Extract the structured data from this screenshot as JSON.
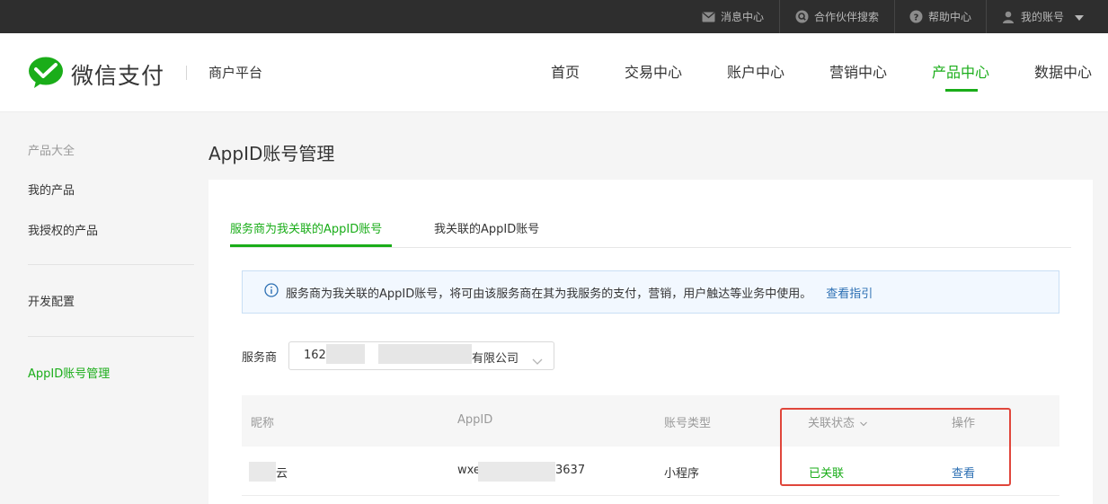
{
  "topbar": {
    "items": [
      {
        "label": "消息中心",
        "icon": "mail-icon"
      },
      {
        "label": "合作伙伴搜索",
        "icon": "search-icon"
      },
      {
        "label": "帮助中心",
        "icon": "help-icon"
      },
      {
        "label": "我的账号",
        "icon": "user-icon"
      }
    ]
  },
  "header": {
    "brand": "微信支付",
    "platform": "商户平台",
    "nav": [
      "首页",
      "交易中心",
      "账户中心",
      "营销中心",
      "产品中心",
      "数据中心"
    ],
    "active_nav": "产品中心"
  },
  "sidebar": {
    "category": "产品大全",
    "items": [
      "我的产品",
      "我授权的产品",
      "开发配置",
      "AppID账号管理"
    ],
    "active": "AppID账号管理"
  },
  "main": {
    "title": "AppID账号管理",
    "tabs": [
      "服务商为我关联的AppID账号",
      "我关联的AppID账号"
    ],
    "active_tab": "服务商为我关联的AppID账号",
    "notice": {
      "text": "服务商为我关联的AppID账号，将可由该服务商在其为我服务的支付，营销，用户触达等业务中使用。",
      "link": "查看指引"
    },
    "filter": {
      "label": "服务商",
      "value_prefix": "162",
      "value_suffix": "有限公司"
    },
    "table": {
      "headers": [
        "昵称",
        "AppID",
        "账号类型",
        "关联状态",
        "操作"
      ],
      "rows": [
        {
          "nickname": "云",
          "appid_prefix": "wxe",
          "appid_suffix": "3637",
          "type": "小程序",
          "status": "已关联",
          "action": "查看"
        }
      ]
    }
  },
  "colors": {
    "brand_green": "#1aad19",
    "link_blue": "#2c6fb3",
    "highlight_red": "#e0463b",
    "topbar_bg": "#2e2e2e"
  }
}
